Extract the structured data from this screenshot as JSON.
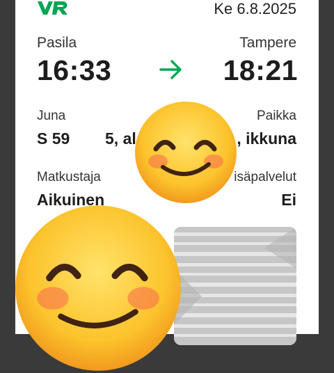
{
  "colors": {
    "background": "#3a3a3a",
    "brand": "#00a651",
    "text": "#1d1d1d"
  },
  "header": {
    "logo_text": "VR",
    "date": "Ke 6.8.2025"
  },
  "journey": {
    "from_station": "Pasila",
    "to_station": "Tampere",
    "departure_time": "16:33",
    "arrival_time": "18:21",
    "arrow_icon": "arrow-right-icon"
  },
  "details": {
    "train_label": "Juna",
    "train_value": "S 59",
    "carriage_value": "5, al",
    "seat_label": "Paikka",
    "seat_value": ", ikkuna",
    "passenger_label": "Matkustaja",
    "passenger_value": "Aikuinen",
    "extras_label": "isäpalvelut",
    "extras_value": "Ei"
  },
  "ticket_code": {
    "icon": "qr-code-icon"
  },
  "overlays": {
    "emoji": "smiling-face-with-smiling-eyes-icon"
  }
}
